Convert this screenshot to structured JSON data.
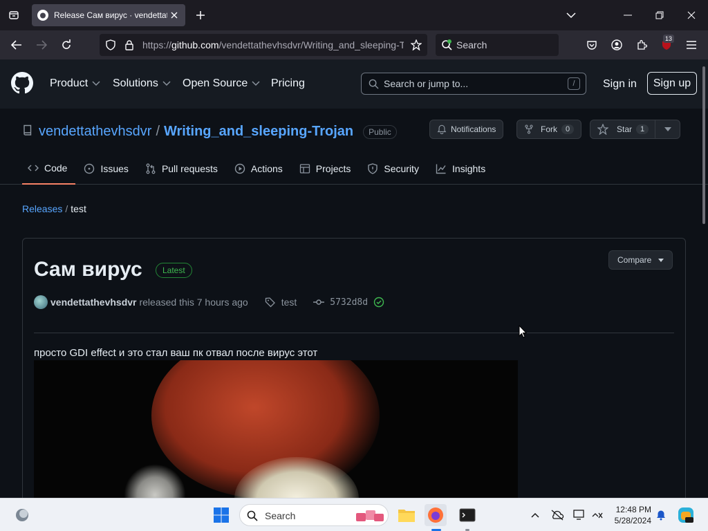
{
  "browser": {
    "tab_title": "Release Сам вирус · vendettathevhsdvr/Writing_and_sleeping-Trojan",
    "url_prefix": "https://",
    "url_domain": "github.com",
    "url_path": "/vendettathevhsdvr/Writing_and_sleeping-Trojan/releases/tag/test",
    "search_placeholder": "Search",
    "extension_badge": "13"
  },
  "github": {
    "nav": [
      "Product",
      "Solutions",
      "Open Source",
      "Pricing"
    ],
    "search_placeholder": "Search or jump to...",
    "search_shortcut": "/",
    "sign_in": "Sign in",
    "sign_up": "Sign up"
  },
  "repo": {
    "owner": "vendettathevhsdvr",
    "separator": "/",
    "name": "Writing_and_sleeping-Trojan",
    "visibility": "Public",
    "notifications_label": "Notifications",
    "fork_label": "Fork",
    "fork_count": "0",
    "star_label": "Star",
    "star_count": "1",
    "tabs": [
      "Code",
      "Issues",
      "Pull requests",
      "Actions",
      "Projects",
      "Security",
      "Insights"
    ]
  },
  "breadcrumb": {
    "link": "Releases",
    "separator": "/",
    "current": "test"
  },
  "release": {
    "title": "Сам вирус",
    "badge": "Latest",
    "compare_label": "Compare",
    "author": "vendettathevhsdvr",
    "released_text": "released this 7 hours ago",
    "tag": "test",
    "commit": "5732d8d",
    "description": "просто GDI effect и это стал ваш пк отвал после вирус этот"
  },
  "taskbar": {
    "search_label": "Search",
    "time": "12:48 PM",
    "date": "5/28/2024"
  },
  "colors": {
    "accent_link": "#58a6ff",
    "latest_green": "#3fb950",
    "active_tab_underline": "#f78166"
  }
}
